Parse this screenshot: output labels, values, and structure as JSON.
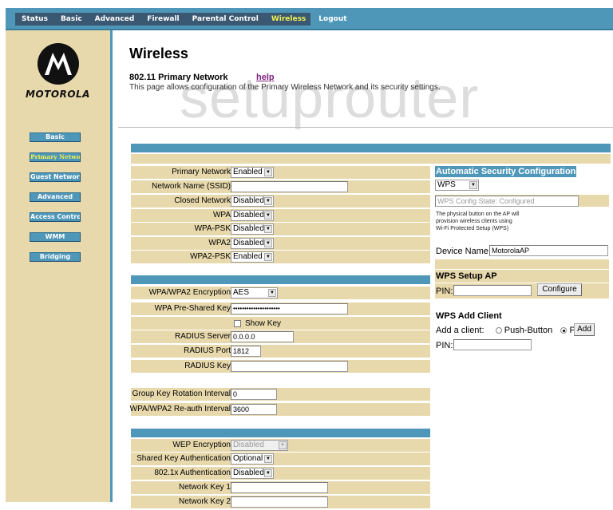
{
  "nav": {
    "items": [
      {
        "label": "Status",
        "active": false
      },
      {
        "label": "Basic",
        "active": false
      },
      {
        "label": "Advanced",
        "active": false
      },
      {
        "label": "Firewall",
        "active": false
      },
      {
        "label": "Parental Control",
        "active": false
      },
      {
        "label": "Wireless",
        "active": true
      },
      {
        "label": "Logout",
        "active": false
      }
    ]
  },
  "brand": {
    "name": "MOTOROLA",
    "logo_icon": "motorola-batwing-logo"
  },
  "sidebar": {
    "items": [
      {
        "label": "Basic",
        "active": false
      },
      {
        "label": "Primary Network",
        "active": true
      },
      {
        "label": "Guest Network",
        "active": false
      },
      {
        "label": "Advanced",
        "active": false
      },
      {
        "label": "Access Control",
        "active": false
      },
      {
        "label": "WMM",
        "active": false
      },
      {
        "label": "Bridging",
        "active": false
      }
    ]
  },
  "header": {
    "title": "Wireless",
    "subtitle": "802.11 Primary Network",
    "help_link": "help",
    "description": "This page allows configuration of the Primary Wireless Network and its security settings."
  },
  "watermark": "setuprouter",
  "primary": {
    "primary_network": {
      "label": "Primary Network",
      "value": "Enabled"
    },
    "ssid": {
      "label": "Network Name (SSID)",
      "value": ""
    },
    "closed_network": {
      "label": "Closed Network",
      "value": "Disabled"
    },
    "wpa": {
      "label": "WPA",
      "value": "Disabled"
    },
    "wpa_psk": {
      "label": "WPA-PSK",
      "value": "Disabled"
    },
    "wpa2": {
      "label": "WPA2",
      "value": "Disabled"
    },
    "wpa2_psk": {
      "label": "WPA2-PSK",
      "value": "Enabled"
    }
  },
  "wpa_settings": {
    "encryption": {
      "label": "WPA/WPA2 Encryption",
      "value": "AES"
    },
    "psk": {
      "label": "WPA Pre-Shared Key",
      "value": "•••••••••••••••••••••"
    },
    "show_key": {
      "label": "Show Key",
      "checked": false
    },
    "radius_server": {
      "label": "RADIUS Server",
      "value": "0.0.0.0"
    },
    "radius_port": {
      "label": "RADIUS Port",
      "value": "1812"
    },
    "radius_key": {
      "label": "RADIUS Key",
      "value": ""
    },
    "group_key_rotation": {
      "label": "Group Key Rotation Interval",
      "value": "0"
    },
    "reauth_interval": {
      "label": "WPA/WPA2 Re-auth Interval",
      "value": "3600"
    }
  },
  "wep": {
    "encryption": {
      "label": "WEP Encryption",
      "value": "Disabled",
      "disabled": true
    },
    "shared_key_auth": {
      "label": "Shared Key Authentication",
      "value": "Optional"
    },
    "auth_8021x": {
      "label": "802.1x Authentication",
      "value": "Disabled"
    },
    "key1": {
      "label": "Network Key 1",
      "value": ""
    },
    "key2": {
      "label": "Network Key 2",
      "value": ""
    }
  },
  "wps": {
    "title": "Automatic Security Configuration",
    "mode": "WPS",
    "config_state": "WPS Config State: Configured",
    "note_lines": [
      "The physical button on the AP will",
      "provision wireless clients using",
      "Wi-Fi Protected Setup (WPS)"
    ],
    "device_name_label": "Device Name",
    "device_name": "MotorolaAP",
    "setup_ap_title": "WPS Setup AP",
    "pin_label": "PIN:",
    "setup_pin": "",
    "configure_button": "Configure",
    "add_client_title": "WPS Add Client",
    "add_client_label": "Add a client:",
    "push_button_label": "Push-Button",
    "pin_option_label": "PIN",
    "selected_method": "PIN",
    "add_button": "Add",
    "client_pin": ""
  },
  "colors": {
    "accent_blue": "#4f97b8",
    "tan": "#e8d9ac",
    "nav_active": "#f0f050",
    "help_link": "#7a1e7a"
  }
}
